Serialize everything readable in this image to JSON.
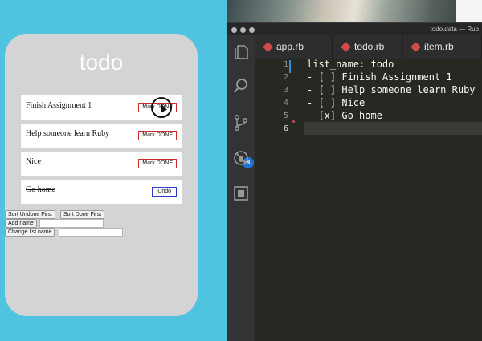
{
  "app": {
    "title": "todo",
    "items": [
      {
        "text": "Finish Assignment 1",
        "button": "Mark DONE",
        "done": false
      },
      {
        "text": "Help someone learn Ruby",
        "button": "Mark DONE",
        "done": false
      },
      {
        "text": "Nice",
        "button": "Mark DONE",
        "done": false
      },
      {
        "text": "Go home",
        "button": "Undo",
        "done": true
      }
    ],
    "controls": {
      "sort_undone_first": "Sort Undone First",
      "sort_done_first": "Sort Done First",
      "add_name": "Add name",
      "add_name_input_value": "",
      "change_list_name": "Change list name",
      "change_list_name_input_value": ""
    }
  },
  "editor": {
    "window_title": "todo.data — Rub",
    "tabs": [
      {
        "label": "app.rb"
      },
      {
        "label": "todo.rb"
      },
      {
        "label": "item.rb"
      }
    ],
    "activity_icons": [
      "files-icon",
      "search-icon",
      "source-control-icon",
      "debug-icon",
      "extensions-icon"
    ],
    "scm_badge": "8",
    "lines": [
      {
        "num": "1",
        "text": "list_name: todo"
      },
      {
        "num": "2",
        "text": "- [ ] Finish Assignment 1"
      },
      {
        "num": "3",
        "text": "- [ ] Help someone learn Ruby"
      },
      {
        "num": "4",
        "text": "- [ ] Nice"
      },
      {
        "num": "5",
        "text": "- [x] Go home"
      },
      {
        "num": "6",
        "text": ""
      }
    ]
  },
  "colors": {
    "background": "#4fc3df",
    "phone": "#d4d4d6",
    "mark_done_border": "#d02b2b",
    "undo_border": "#2b3bd0",
    "editor_bg": "#272822",
    "badge": "#1f76d2"
  }
}
